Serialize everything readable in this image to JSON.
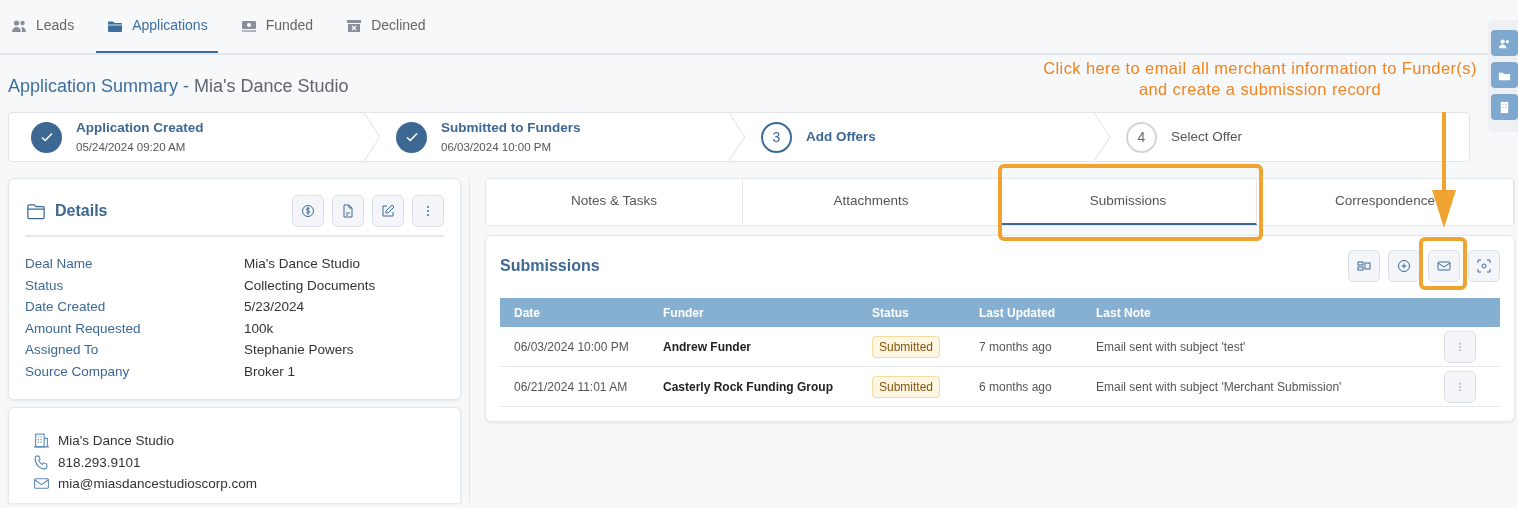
{
  "top_tabs": [
    {
      "label": "Leads",
      "selected": false
    },
    {
      "label": "Applications",
      "selected": true
    },
    {
      "label": "Funded",
      "selected": false
    },
    {
      "label": "Declined",
      "selected": false
    }
  ],
  "title": {
    "prefix": "Application Summary -",
    "name": "Mia's Dance Studio"
  },
  "steps": [
    {
      "completed": true,
      "label": "Application Created",
      "date": "05/24/2024 09:20 AM"
    },
    {
      "completed": true,
      "label": "Submitted to Funders",
      "date": "06/03/2024 10:00 PM"
    },
    {
      "completed": false,
      "active": true,
      "number": "3",
      "label": "Add Offers"
    },
    {
      "completed": false,
      "active": false,
      "number": "4",
      "label": "Select Offer"
    }
  ],
  "details": {
    "title": "Details",
    "fields": [
      {
        "label": "Deal Name",
        "value": "Mia's Dance Studio"
      },
      {
        "label": "Status",
        "value": "Collecting Documents"
      },
      {
        "label": "Date Created",
        "value": "5/23/2024"
      },
      {
        "label": "Amount Requested",
        "value": "100k"
      },
      {
        "label": "Assigned To",
        "value": "Stephanie Powers"
      },
      {
        "label": "Source Company",
        "value": "Broker 1"
      }
    ]
  },
  "contact": [
    {
      "kind": "company",
      "text": "Mia's Dance Studio"
    },
    {
      "kind": "phone",
      "text": "818.293.9101"
    },
    {
      "kind": "email",
      "text": "mia@miasdancestudioscorp.com"
    }
  ],
  "section_tabs": [
    {
      "label": "Notes & Tasks",
      "selected": false
    },
    {
      "label": "Attachments",
      "selected": false
    },
    {
      "label": "Submissions",
      "selected": true
    },
    {
      "label": "Correspondence",
      "selected": false
    }
  ],
  "submissions": {
    "title": "Submissions",
    "columns": [
      "Date",
      "Funder",
      "Status",
      "Last Updated",
      "Last Note"
    ],
    "rows": [
      {
        "date": "06/03/2024 10:00 PM",
        "funder": "Andrew Funder",
        "status": "Submitted",
        "updated": "7 months ago",
        "note": "Email sent with subject 'test'"
      },
      {
        "date": "06/21/2024 11:01 AM",
        "funder": "Casterly Rock Funding Group",
        "status": "Submitted",
        "updated": "6 months ago",
        "note": "Email sent with subject 'Merchant Submission'"
      }
    ]
  },
  "callout": {
    "text": "Click here to email all merchant information to Funder(s) and create a submission record"
  }
}
